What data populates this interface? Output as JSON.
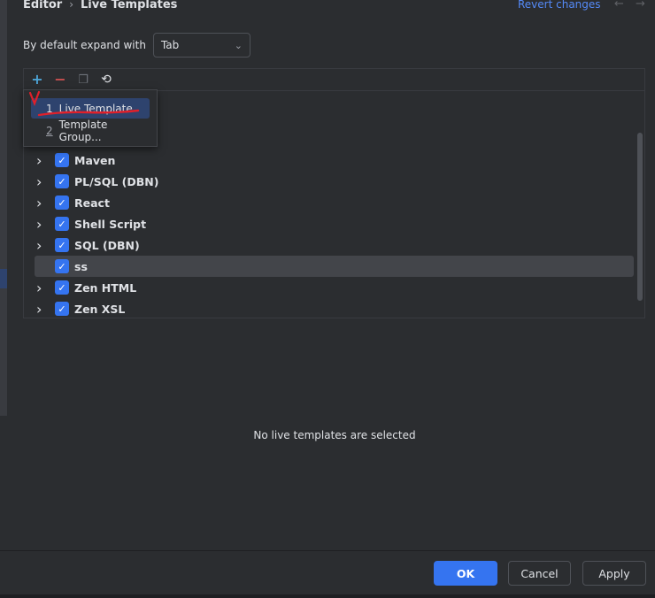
{
  "breadcrumb": {
    "parent": "Editor",
    "current": "Live Templates"
  },
  "header": {
    "revert_label": "Revert changes"
  },
  "expand": {
    "label": "By default expand with",
    "selected": "Tab"
  },
  "toolbar": {
    "add_icon": "plus-icon",
    "remove_icon": "minus-icon",
    "copy_icon": "copy-icon",
    "restore_icon": "restore-icon"
  },
  "popup": {
    "items": [
      {
        "mnemonic": "1",
        "label": "Live Template"
      },
      {
        "mnemonic": "2",
        "label": "Template Group..."
      }
    ]
  },
  "tree": {
    "rows": [
      {
        "label": "Maven",
        "checked": true,
        "expandable": true
      },
      {
        "label": "PL/SQL (DBN)",
        "checked": true,
        "expandable": true
      },
      {
        "label": "React",
        "checked": true,
        "expandable": true
      },
      {
        "label": "Shell Script",
        "checked": true,
        "expandable": true
      },
      {
        "label": "SQL (DBN)",
        "checked": true,
        "expandable": true
      },
      {
        "label": "ss",
        "checked": true,
        "expandable": false,
        "selected": true
      },
      {
        "label": "Zen HTML",
        "checked": true,
        "expandable": true
      },
      {
        "label": "Zen XSL",
        "checked": true,
        "expandable": true
      }
    ]
  },
  "details": {
    "empty_message": "No live templates are selected"
  },
  "buttons": {
    "ok": "OK",
    "cancel": "Cancel",
    "apply": "Apply"
  },
  "colors": {
    "accent": "#3574f0",
    "selection": "#2e436e",
    "annotation": "#e0202a"
  }
}
